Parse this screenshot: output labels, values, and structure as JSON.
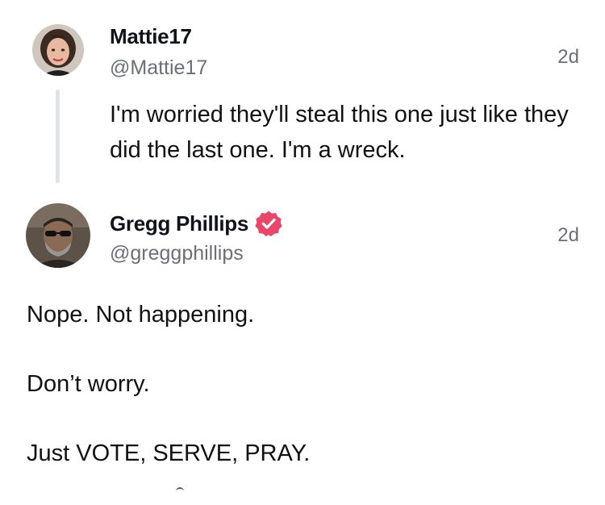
{
  "reply": {
    "author_name": "Mattie17",
    "author_handle": "@Mattie17",
    "timestamp": "2d",
    "text": "I'm worried they'll steal this one just like they did the last one. I'm a wreck.",
    "avatar": "woman-portrait-avatar"
  },
  "main": {
    "author_name": "Gregg Phillips",
    "author_handle": "@greggphillips",
    "timestamp": "2d",
    "verified_icon": "verified-badge-icon",
    "verified_color": "#e8476b",
    "avatar": "man-sunglasses-avatar",
    "paragraphs": [
      "Nope. Not happening.",
      "Don’t worry.",
      "Just VOTE, SERVE, PRAY."
    ]
  },
  "colors": {
    "text": "#111111",
    "muted": "#6b6f76",
    "thread_line": "#e2e3e6"
  }
}
